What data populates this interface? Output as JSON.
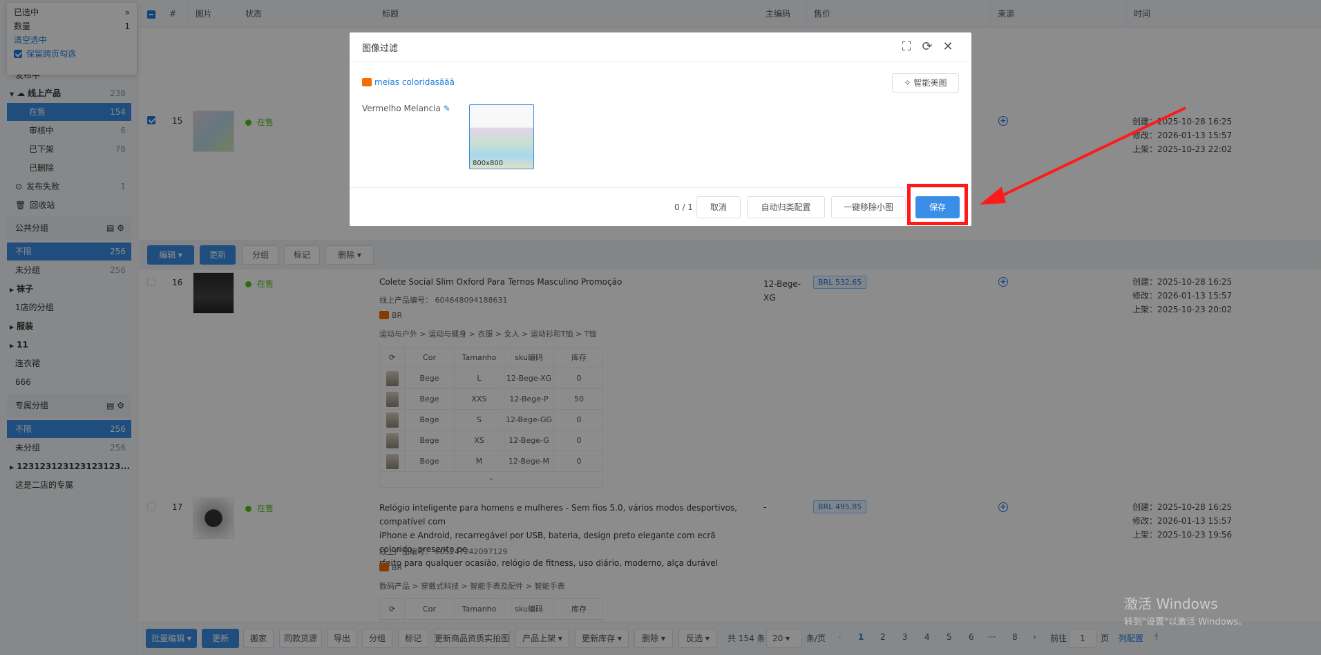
{
  "selection": {
    "title": "已选中",
    "count_label": "数量",
    "count_value": "1",
    "clear_label": "清空选中",
    "keep_label": "保留跨页勾选"
  },
  "sidebar": {
    "partial_item": "发布中",
    "online": {
      "label": "线上产品",
      "count": "238"
    },
    "online_items": [
      {
        "label": "在售",
        "count": "154"
      },
      {
        "label": "审核中",
        "count": "6"
      },
      {
        "label": "已下架",
        "count": "78"
      },
      {
        "label": "已删除",
        "count": ""
      }
    ],
    "failed": {
      "label": "发布失败",
      "count": "1"
    },
    "recycle": {
      "label": "回收站"
    },
    "public_group": {
      "title": "公共分组"
    },
    "public_items": [
      {
        "label": "不限",
        "count": "256"
      },
      {
        "label": "未分组",
        "count": "256"
      },
      {
        "label": "袜子",
        "count": ""
      },
      {
        "label": "1店的分组",
        "count": ""
      },
      {
        "label": "服装",
        "count": ""
      },
      {
        "label": "11",
        "count": ""
      },
      {
        "label": "连衣裙",
        "count": ""
      },
      {
        "label": "666",
        "count": ""
      }
    ],
    "private_group": {
      "title": "专属分组"
    },
    "private_items": [
      {
        "label": "不限",
        "count": "256"
      },
      {
        "label": "未分组",
        "count": "256"
      },
      {
        "label": "123123123123123123...",
        "count": ""
      },
      {
        "label": "这是二店的专属",
        "count": ""
      }
    ]
  },
  "table": {
    "headers": {
      "index": "#",
      "image": "图片",
      "status": "状态",
      "title": "标题",
      "code": "主编码",
      "price": "售价",
      "source": "来源",
      "time": "时间"
    },
    "rows": [
      {
        "index": "15",
        "status": "在售",
        "times": [
          "创建：2025-10-28 16:25",
          "修改：2026-01-13 15:57",
          "上架：2025-10-23 22:02"
        ]
      },
      {
        "index": "16",
        "status": "在售",
        "title": "Colete Social Slim Oxford Para Ternos Masculino Promoção",
        "product_no": "线上产品编号：  604648094188631",
        "region": "BR",
        "category": "运动与户外 > 运动与健身 > 衣服 > 女人 > 运动衫和T恤 > T恤",
        "code": "12-Bege-XG",
        "price": "BRL 532,65",
        "times": [
          "创建：2025-10-28 16:25",
          "修改：2026-01-13 15:57",
          "上架：2025-10-23 20:02"
        ],
        "sku_headers": [
          "Cor",
          "Tamanho",
          "sku编码",
          "库存"
        ],
        "sku_rows": [
          [
            "Bege",
            "L",
            "12-Bege-XG",
            "0"
          ],
          [
            "Bege",
            "XXS",
            "12-Bege-P",
            "50"
          ],
          [
            "Bege",
            "S",
            "12-Bege-GG",
            "0"
          ],
          [
            "Bege",
            "XS",
            "12-Bege-G",
            "0"
          ],
          [
            "Bege",
            "M",
            "12-Bege-M",
            "0"
          ]
        ]
      },
      {
        "index": "17",
        "status": "在售",
        "title_lines": [
          "Relógio inteligente para homens e mulheres - Sem fios 5.0, vários modos desportivos, compatível com",
          "iPhone e Android, recarregável por USB, bateria, design preto elegante com ecrã colorido, presente pe",
          "rfeito para qualquer ocasião, relógio de fitness, uso diário, moderno, alça durável"
        ],
        "product_no": "线上产品编号：  605247242097129",
        "region": "BR",
        "category": "数码产品 > 穿戴式科技 > 智能手表及配件 > 智能手表",
        "code": "-",
        "price": "BRL 495,85",
        "times": [
          "创建：2025-10-28 16:25",
          "修改：2026-01-13 15:57",
          "上架：2025-10-23 19:56"
        ],
        "sku_headers": [
          "Cor",
          "Tamanho",
          "sku编码",
          "库存"
        ]
      }
    ]
  },
  "row_toolbar": {
    "edit": "编辑",
    "update": "更新",
    "group": "分组",
    "mark": "标记",
    "delete": "删除"
  },
  "bottom": {
    "batch_edit": "批量编辑",
    "update": "更新",
    "move": "搬家",
    "same_source": "同款货源",
    "export": "导出",
    "group": "分组",
    "mark": "标记",
    "update_images": "更新商品资质实拍图",
    "list": "产品上架",
    "update_stock": "更新库存",
    "delete": "删除",
    "invert": "反选",
    "total": "共 154 条",
    "page_size": "20",
    "per_page": "条/页",
    "pages": [
      "1",
      "2",
      "3",
      "4",
      "5",
      "6",
      "···",
      "8"
    ],
    "goto": "前往",
    "goto_value": "1",
    "page_unit": "页",
    "column_config": "列配置"
  },
  "modal": {
    "title": "图像过滤",
    "product_name": "meias coloridasããã",
    "beautify": "智能美图",
    "variant": "Vermelho Melancia",
    "image_size": "800x800",
    "counter": "0 / 1",
    "cancel": "取消",
    "auto_classify": "自动归类配置",
    "remove_small": "一键移除小图",
    "save": "保存"
  },
  "watermark": {
    "line1": "激活 Windows",
    "line2": "转到\"设置\"以激活 Windows。"
  }
}
